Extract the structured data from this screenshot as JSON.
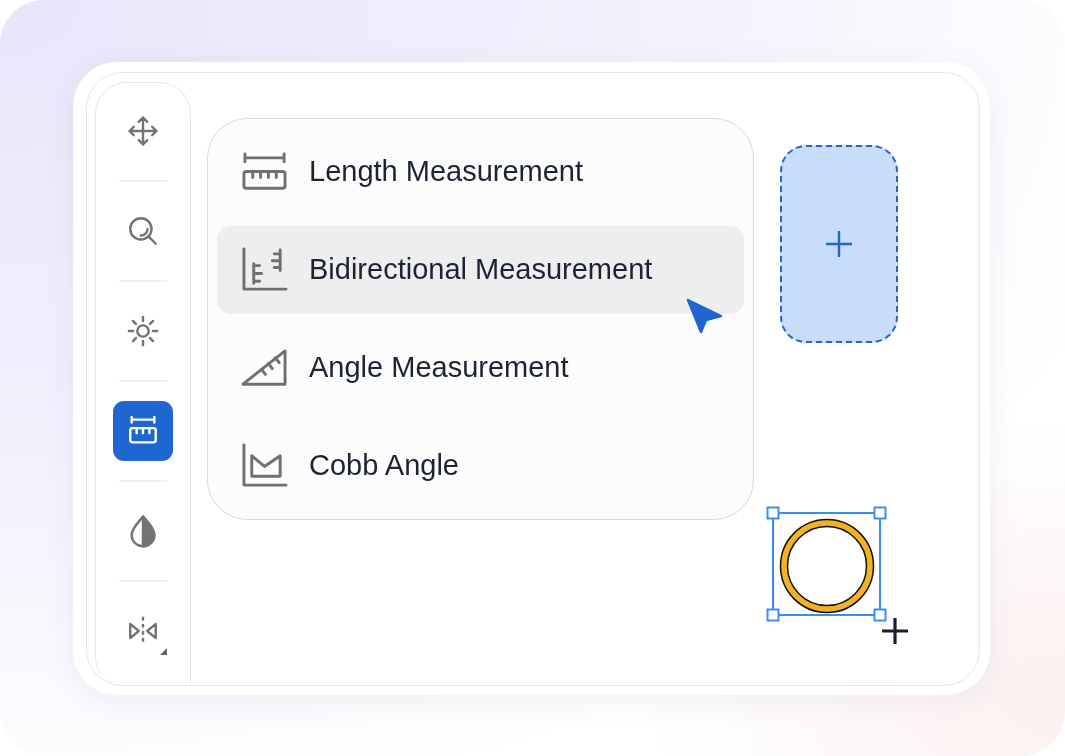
{
  "toolbar": {
    "tools": [
      {
        "kind": "move",
        "selected": false,
        "has_submenu": false
      },
      {
        "kind": "zoom",
        "selected": false,
        "has_submenu": false
      },
      {
        "kind": "brightness",
        "selected": false,
        "has_submenu": false
      },
      {
        "kind": "measure",
        "selected": true,
        "has_submenu": false
      },
      {
        "kind": "contrast",
        "selected": false,
        "has_submenu": false
      },
      {
        "kind": "flip",
        "selected": false,
        "has_submenu": true
      }
    ]
  },
  "measure_menu": {
    "items": [
      {
        "kind": "length",
        "label": "Length Measurement",
        "selected": false
      },
      {
        "kind": "bidirectional",
        "label": "Bidirectional Measurement",
        "selected": true
      },
      {
        "kind": "angle",
        "label": "Angle Measurement",
        "selected": false
      },
      {
        "kind": "cobb",
        "label": "Cobb Angle",
        "selected": false
      }
    ]
  },
  "canvas": {
    "circle_annotation": {
      "selected": true
    }
  }
}
